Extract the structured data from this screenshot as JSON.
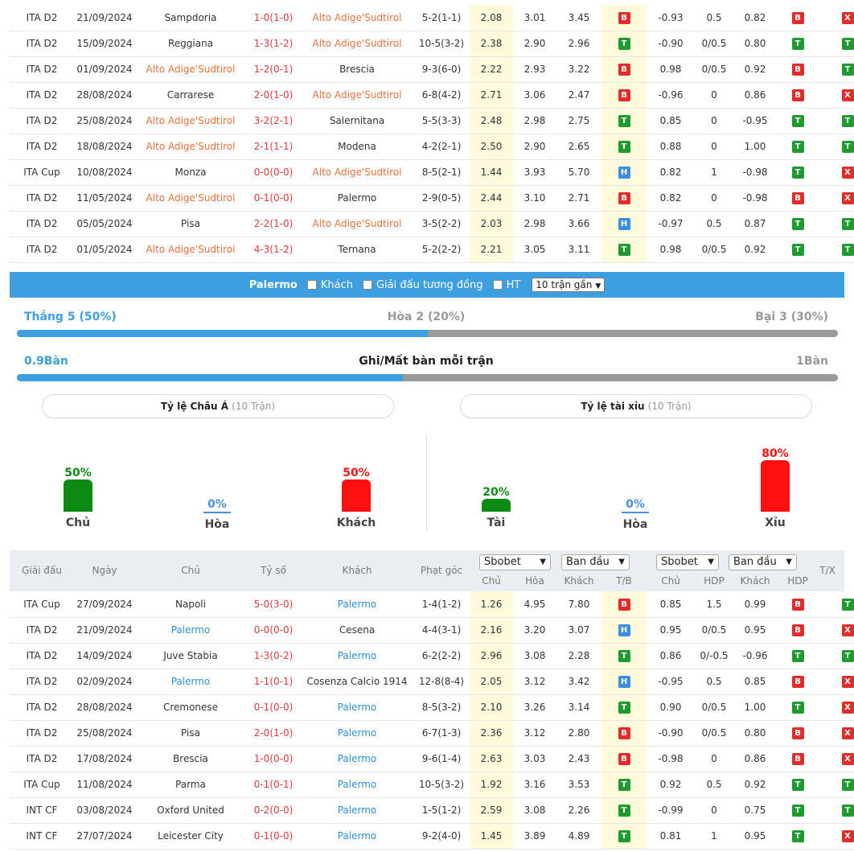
{
  "top_table": {
    "rows": [
      {
        "league": "ITA D2",
        "date": "21/09/2024",
        "home": "Sampdoria",
        "home_hl": "",
        "score": "1-0(1-0)",
        "away": "Alto Adige'Sudtirol",
        "away_hl": "orange",
        "corners": "5-2(1-1)",
        "o1": "2.08",
        "o2": "3.01",
        "o3": "3.45",
        "r1": "B",
        "h1": "-0.93",
        "h2": "0.5",
        "h3": "0.82",
        "r2": "B",
        "r3": "X"
      },
      {
        "league": "ITA D2",
        "date": "15/09/2024",
        "home": "Reggiana",
        "home_hl": "",
        "score": "1-3(1-2)",
        "away": "Alto Adige'Sudtirol",
        "away_hl": "orange",
        "corners": "10-5(3-2)",
        "o1": "2.38",
        "o2": "2.90",
        "o3": "2.96",
        "r1": "T",
        "h1": "-0.90",
        "h2": "0/0.5",
        "h3": "0.80",
        "r2": "T",
        "r3": "T"
      },
      {
        "league": "ITA D2",
        "date": "01/09/2024",
        "home": "Alto Adige'Sudtirol",
        "home_hl": "orange",
        "score": "1-2(0-1)",
        "away": "Brescia",
        "away_hl": "",
        "corners": "9-3(6-0)",
        "o1": "2.22",
        "o2": "2.93",
        "o3": "3.22",
        "r1": "B",
        "h1": "0.98",
        "h2": "0/0.5",
        "h3": "0.92",
        "r2": "B",
        "r3": "T"
      },
      {
        "league": "ITA D2",
        "date": "28/08/2024",
        "home": "Carrarese",
        "home_hl": "",
        "score": "2-0(1-0)",
        "away": "Alto Adige'Sudtirol",
        "away_hl": "orange",
        "corners": "6-8(4-2)",
        "o1": "2.71",
        "o2": "3.06",
        "o3": "2.47",
        "r1": "B",
        "h1": "-0.96",
        "h2": "0",
        "h3": "0.86",
        "r2": "B",
        "r3": "X"
      },
      {
        "league": "ITA D2",
        "date": "25/08/2024",
        "home": "Alto Adige'Sudtirol",
        "home_hl": "orange",
        "score": "3-2(2-1)",
        "away": "Salernitana",
        "away_hl": "",
        "corners": "5-5(3-3)",
        "o1": "2.48",
        "o2": "2.98",
        "o3": "2.75",
        "r1": "T",
        "h1": "0.85",
        "h2": "0",
        "h3": "-0.95",
        "r2": "T",
        "r3": "T"
      },
      {
        "league": "ITA D2",
        "date": "18/08/2024",
        "home": "Alto Adige'Sudtirol",
        "home_hl": "orange",
        "score": "2-1(1-1)",
        "away": "Modena",
        "away_hl": "",
        "corners": "4-2(2-1)",
        "o1": "2.50",
        "o2": "2.90",
        "o3": "2.65",
        "r1": "T",
        "h1": "0.88",
        "h2": "0",
        "h3": "1.00",
        "r2": "T",
        "r3": "T"
      },
      {
        "league": "ITA Cup",
        "date": "10/08/2024",
        "home": "Monza",
        "home_hl": "",
        "score": "0-0(0-0)",
        "away": "Alto Adige'Sudtirol",
        "away_hl": "orange",
        "corners": "8-5(2-1)",
        "o1": "1.44",
        "o2": "3.93",
        "o3": "5.70",
        "r1": "H",
        "h1": "0.82",
        "h2": "1",
        "h3": "-0.98",
        "r2": "T",
        "r3": "X"
      },
      {
        "league": "ITA D2",
        "date": "11/05/2024",
        "home": "Alto Adige'Sudtirol",
        "home_hl": "orange",
        "score": "0-1(0-0)",
        "away": "Palermo",
        "away_hl": "",
        "corners": "2-9(0-5)",
        "o1": "2.44",
        "o2": "3.10",
        "o3": "2.71",
        "r1": "B",
        "h1": "0.82",
        "h2": "0",
        "h3": "-0.98",
        "r2": "B",
        "r3": "X"
      },
      {
        "league": "ITA D2",
        "date": "05/05/2024",
        "home": "Pisa",
        "home_hl": "",
        "score": "2-2(1-0)",
        "away": "Alto Adige'Sudtirol",
        "away_hl": "orange",
        "corners": "3-5(2-2)",
        "o1": "2.03",
        "o2": "2.98",
        "o3": "3.66",
        "r1": "H",
        "h1": "-0.97",
        "h2": "0.5",
        "h3": "0.87",
        "r2": "T",
        "r3": "T"
      },
      {
        "league": "ITA D2",
        "date": "01/05/2024",
        "home": "Alto Adige'Sudtirol",
        "home_hl": "orange",
        "score": "4-3(1-2)",
        "away": "Ternana",
        "away_hl": "",
        "corners": "5-2(2-2)",
        "o1": "2.21",
        "o2": "3.05",
        "o3": "3.11",
        "r1": "T",
        "h1": "0.98",
        "h2": "0/0.5",
        "h3": "0.92",
        "r2": "T",
        "r3": "T"
      }
    ]
  },
  "filter": {
    "team": "Palermo",
    "away_label": "Khách",
    "same_league_label": "Giải đấu tương đồng",
    "ht_label": "HT",
    "recent_select": "10 trận gần"
  },
  "form": {
    "win": "Thắng 5 (50%)",
    "draw": "Hòa 2 (20%)",
    "loss": "Bại 3 (30%)",
    "win_fraction": 0.5
  },
  "goals": {
    "left": "0.9Bàn",
    "title": "Ghi/Mất bàn mỗi trận",
    "right": "1Bàn",
    "left_fraction": 0.47
  },
  "asian": {
    "title": "Tỷ lệ Châu Á",
    "count": "(10 Trận)",
    "cols": [
      {
        "pct": "50%",
        "label": "Chủ",
        "value": 50,
        "color": "#0d8a14"
      },
      {
        "pct": "0%",
        "label": "Hòa",
        "value": 0,
        "color": "#4a90d9"
      },
      {
        "pct": "50%",
        "label": "Khách",
        "value": 50,
        "color": "#ff1010"
      }
    ]
  },
  "ou": {
    "title": "Tỷ lệ tài xỉu",
    "count": "(10 Trận)",
    "cols": [
      {
        "pct": "20%",
        "label": "Tài",
        "value": 20,
        "color": "#0d8a14"
      },
      {
        "pct": "0%",
        "label": "Hòa",
        "value": 0,
        "color": "#4a90d9"
      },
      {
        "pct": "80%",
        "label": "Xỉu",
        "value": 80,
        "color": "#ff1010"
      }
    ]
  },
  "bottom_header": {
    "league": "Giải đấu",
    "date": "Ngày",
    "home": "Chủ",
    "score": "Tỷ số",
    "away": "Khách",
    "corners": "Phạt góc",
    "book1": "Sbobet",
    "type1": "Ban đầu",
    "book2": "Sbobet",
    "type2": "Ban đầu",
    "tx": "T/X",
    "sub": [
      "Chủ",
      "Hòa",
      "Khách",
      "T/B",
      "Chủ",
      "HDP",
      "Khách",
      "HDP"
    ]
  },
  "bottom_table": {
    "rows": [
      {
        "league": "ITA Cup",
        "date": "27/09/2024",
        "home": "Napoli",
        "home_hl": "",
        "score": "5-0(3-0)",
        "away": "Palermo",
        "away_hl": "blue",
        "corners": "1-4(1-2)",
        "o1": "1.26",
        "o2": "4.95",
        "o3": "7.80",
        "r1": "B",
        "h1": "0.85",
        "h2": "1.5",
        "h3": "0.99",
        "r2": "B",
        "r3": "T"
      },
      {
        "league": "ITA D2",
        "date": "21/09/2024",
        "home": "Palermo",
        "home_hl": "blue",
        "score": "0-0(0-0)",
        "away": "Cesena",
        "away_hl": "",
        "corners": "4-4(3-1)",
        "o1": "2.16",
        "o2": "3.20",
        "o3": "3.07",
        "r1": "H",
        "h1": "0.95",
        "h2": "0/0.5",
        "h3": "0.95",
        "r2": "B",
        "r3": "X"
      },
      {
        "league": "ITA D2",
        "date": "14/09/2024",
        "home": "Juve Stabia",
        "home_hl": "",
        "score": "1-3(0-2)",
        "away": "Palermo",
        "away_hl": "blue",
        "corners": "6-2(2-2)",
        "o1": "2.96",
        "o2": "3.08",
        "o3": "2.28",
        "r1": "T",
        "h1": "0.86",
        "h2": "0/-0.5",
        "h3": "-0.96",
        "r2": "T",
        "r3": "T"
      },
      {
        "league": "ITA D2",
        "date": "02/09/2024",
        "home": "Palermo",
        "home_hl": "blue",
        "score": "1-1(0-1)",
        "away": "Cosenza Calcio 1914",
        "away_hl": "",
        "corners": "12-8(8-4)",
        "o1": "2.05",
        "o2": "3.12",
        "o3": "3.42",
        "r1": "H",
        "h1": "-0.95",
        "h2": "0.5",
        "h3": "0.85",
        "r2": "B",
        "r3": "X"
      },
      {
        "league": "ITA D2",
        "date": "28/08/2024",
        "home": "Cremonese",
        "home_hl": "",
        "score": "0-1(0-0)",
        "away": "Palermo",
        "away_hl": "blue",
        "corners": "8-5(3-2)",
        "o1": "2.10",
        "o2": "3.26",
        "o3": "3.14",
        "r1": "T",
        "h1": "0.90",
        "h2": "0/0.5",
        "h3": "1.00",
        "r2": "T",
        "r3": "X"
      },
      {
        "league": "ITA D2",
        "date": "25/08/2024",
        "home": "Pisa",
        "home_hl": "",
        "score": "2-0(1-0)",
        "away": "Palermo",
        "away_hl": "blue",
        "corners": "6-7(1-3)",
        "o1": "2.36",
        "o2": "3.12",
        "o3": "2.80",
        "r1": "B",
        "h1": "-0.90",
        "h2": "0/0.5",
        "h3": "0.80",
        "r2": "B",
        "r3": "X"
      },
      {
        "league": "ITA D2",
        "date": "17/08/2024",
        "home": "Brescia",
        "home_hl": "",
        "score": "1-0(0-0)",
        "away": "Palermo",
        "away_hl": "blue",
        "corners": "9-6(1-4)",
        "o1": "2.63",
        "o2": "3.03",
        "o3": "2.43",
        "r1": "B",
        "h1": "-0.98",
        "h2": "0",
        "h3": "0.86",
        "r2": "B",
        "r3": "X"
      },
      {
        "league": "ITA Cup",
        "date": "11/08/2024",
        "home": "Parma",
        "home_hl": "",
        "score": "0-1(0-1)",
        "away": "Palermo",
        "away_hl": "blue",
        "corners": "10-5(3-2)",
        "o1": "1.92",
        "o2": "3.16",
        "o3": "3.53",
        "r1": "T",
        "h1": "0.92",
        "h2": "0.5",
        "h3": "0.92",
        "r2": "T",
        "r3": "T"
      },
      {
        "league": "INT CF",
        "date": "03/08/2024",
        "home": "Oxford United",
        "home_hl": "",
        "score": "0-2(0-0)",
        "away": "Palermo",
        "away_hl": "blue",
        "corners": "1-5(1-2)",
        "o1": "2.59",
        "o2": "3.08",
        "o3": "2.26",
        "r1": "T",
        "h1": "-0.99",
        "h2": "0",
        "h3": "0.75",
        "r2": "T",
        "r3": "T"
      },
      {
        "league": "INT CF",
        "date": "27/07/2024",
        "home": "Leicester City",
        "home_hl": "",
        "score": "0-1(0-0)",
        "away": "Palermo",
        "away_hl": "blue",
        "corners": "9-2(4-0)",
        "o1": "1.45",
        "o2": "3.89",
        "o3": "4.89",
        "r1": "T",
        "h1": "0.81",
        "h2": "1",
        "h3": "0.95",
        "r2": "T",
        "r3": "X"
      }
    ]
  }
}
